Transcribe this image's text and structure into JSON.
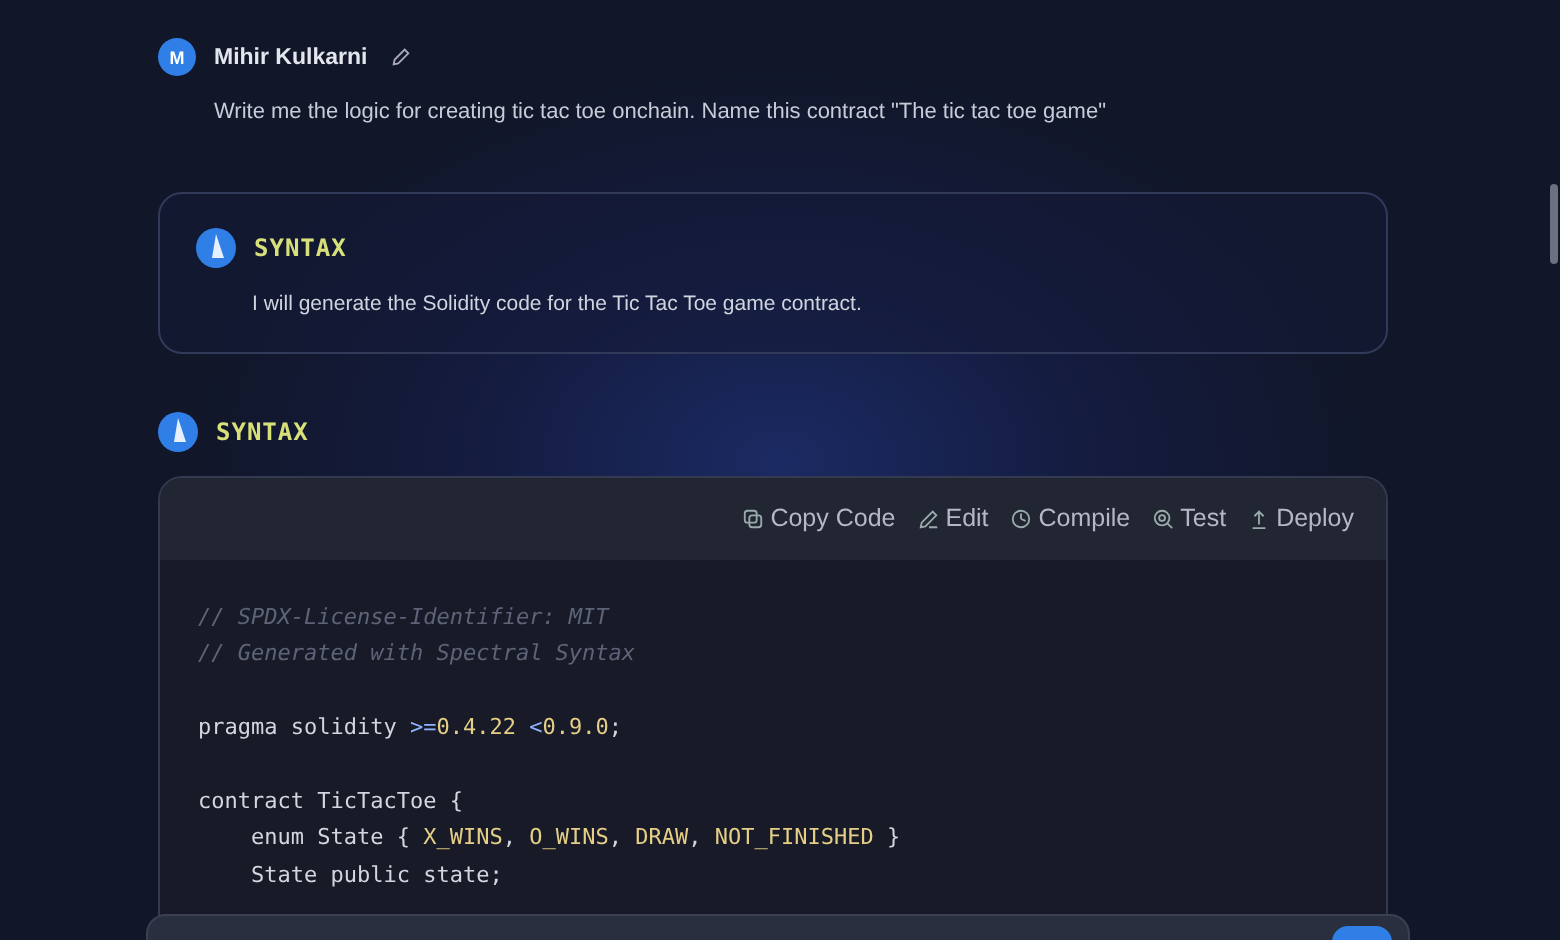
{
  "user_message": {
    "avatar": "M",
    "name": "Mihir Kulkarni",
    "text": "Write me the logic for creating tic tac toe onchain. Name this contract \"The tic tac toe game\""
  },
  "assistant_message": {
    "name": "SYNTAX",
    "text": "I will generate the Solidity code for the Tic Tac Toe game contract."
  },
  "code_message": {
    "name": "SYNTAX",
    "actions": [
      {
        "label": "Copy Code",
        "kind": "copy"
      },
      {
        "label": "Edit",
        "kind": "edit"
      },
      {
        "label": "Compile",
        "kind": "compile"
      },
      {
        "label": "Test",
        "kind": "test"
      },
      {
        "label": "Deploy",
        "kind": "deploy"
      }
    ],
    "lines": [
      {
        "segments": [
          {
            "text": "// SPDX-License-Identifier: MIT",
            "kind": "comment"
          }
        ]
      },
      {
        "segments": [
          {
            "text": "// Generated with Spectral Syntax",
            "kind": "comment"
          }
        ]
      },
      {
        "blank_before": true,
        "segments": [
          {
            "text": "pragma solidity ",
            "kind": "plain"
          },
          {
            "text": ">=",
            "kind": "operator"
          },
          {
            "text": "0.4.22 ",
            "kind": "number"
          },
          {
            "text": "<",
            "kind": "operator"
          },
          {
            "text": "0.9.0",
            "kind": "number"
          },
          {
            "text": ";",
            "kind": "plain"
          }
        ]
      },
      {
        "blank_before": true,
        "segments": [
          {
            "text": "contract TicTacToe {",
            "kind": "plain"
          }
        ]
      },
      {
        "segments": [
          {
            "text": "    enum State { ",
            "kind": "plain"
          },
          {
            "text": "X_WINS",
            "kind": "constant"
          },
          {
            "text": ", ",
            "kind": "plain"
          },
          {
            "text": "O_WINS",
            "kind": "constant"
          },
          {
            "text": ", ",
            "kind": "plain"
          },
          {
            "text": "DRAW",
            "kind": "constant"
          },
          {
            "text": ", ",
            "kind": "plain"
          },
          {
            "text": "NOT_FINISHED",
            "kind": "constant"
          },
          {
            "text": " }",
            "kind": "plain"
          }
        ]
      },
      {
        "segments": [
          {
            "text": "    State public state;",
            "kind": "plain"
          }
        ]
      }
    ]
  }
}
